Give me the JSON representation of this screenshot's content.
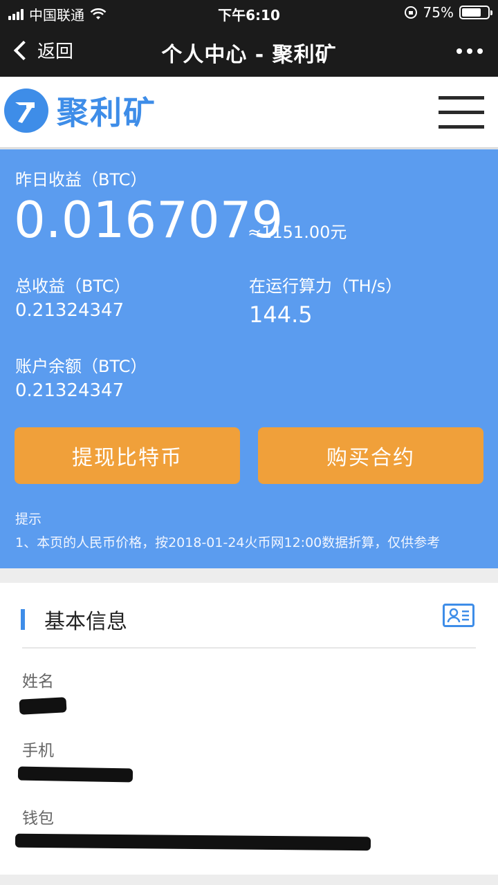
{
  "status_bar": {
    "carrier": "中国联通",
    "time": "下午6:10",
    "battery_percent": "75%",
    "battery_level": 0.75
  },
  "nav": {
    "back_label": "返回",
    "title": "个人中心 - 聚利矿"
  },
  "brand": {
    "logo_text": "聚利矿"
  },
  "earnings": {
    "yesterday_label": "昨日收益（BTC）",
    "yesterday_value": "0.0167079",
    "yesterday_cny": "≈1151.00元",
    "total_label": "总收益（BTC）",
    "total_value": "0.21324347",
    "hashrate_label": "在运行算力（TH/s）",
    "hashrate_value": "144.5",
    "balance_label": "账户余额（BTC）",
    "balance_value": "0.21324347",
    "withdraw_button": "提现比特币",
    "buy_button": "购买合约",
    "tip_title": "提示",
    "tip_text": "1、本页的人民币价格，按2018-01-24火币网12:00数据折算，仅供参考"
  },
  "info": {
    "title": "基本信息",
    "name_label": "姓名",
    "phone_label": "手机",
    "wallet_label": "钱包"
  },
  "colors": {
    "brand_blue": "#3e8de8",
    "panel_blue": "#5b9cef",
    "button_orange": "#f0a03a"
  }
}
